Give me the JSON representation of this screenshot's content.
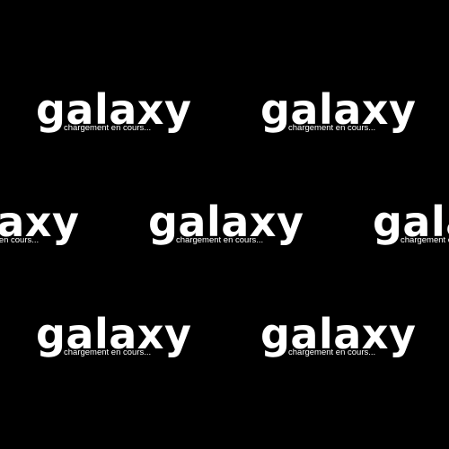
{
  "colors": {
    "background": "#000000",
    "logo": "#ffffff"
  },
  "logo": {
    "wordmark": "galaxy",
    "tagline": "chargement en cours..."
  }
}
